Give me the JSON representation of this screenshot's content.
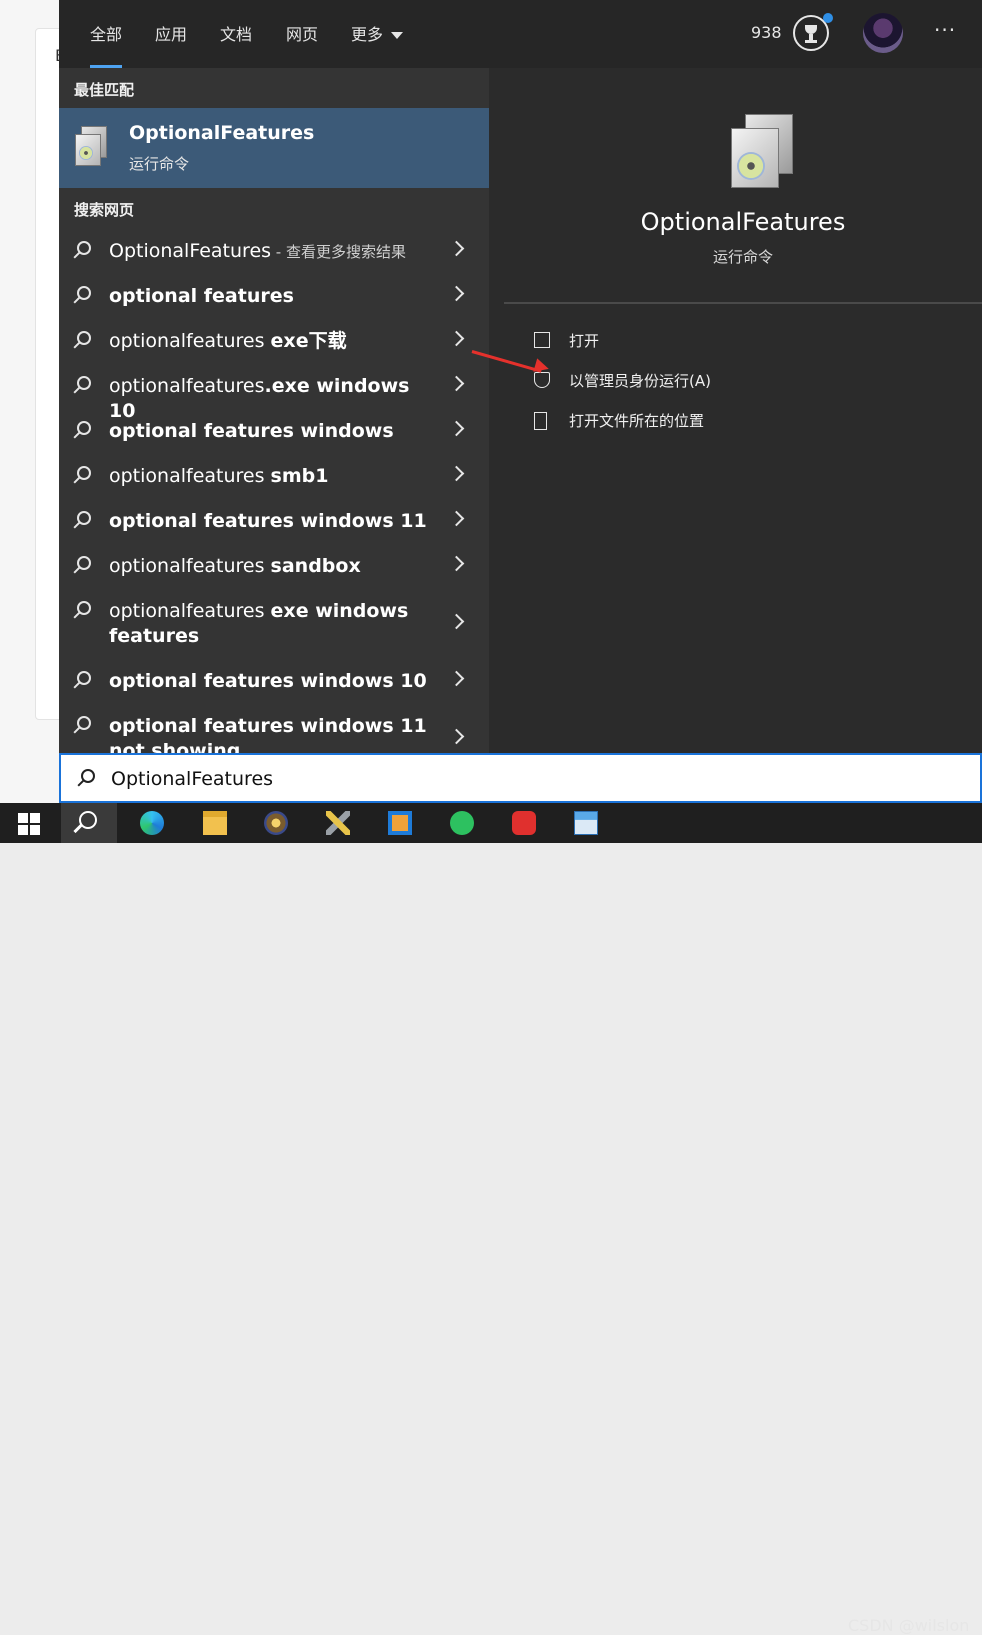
{
  "tabs": [
    {
      "label": "全部"
    },
    {
      "label": "应用"
    },
    {
      "label": "文档"
    },
    {
      "label": "网页"
    },
    {
      "label": "更多"
    }
  ],
  "header": {
    "points": "938",
    "ellipsis": "···"
  },
  "background": {
    "letter": "B"
  },
  "best_match": {
    "section_label": "最佳匹配",
    "title": "OptionalFeatures",
    "subtitle": "运行命令"
  },
  "web": {
    "section_label": "搜索网页",
    "results": [
      {
        "normal": "OptionalFeatures",
        "bold": "",
        "suffix": " - 查看更多搜索结果"
      },
      {
        "normal": "",
        "bold": "optional features",
        "suffix": ""
      },
      {
        "normal": "optionalfeatures ",
        "bold": "exe下载",
        "suffix": ""
      },
      {
        "normal": "optionalfeatures",
        "bold": ".exe windows 10",
        "suffix": ""
      },
      {
        "normal": "",
        "bold": "optional features windows",
        "suffix": ""
      },
      {
        "normal": "optionalfeatures ",
        "bold": "smb1",
        "suffix": ""
      },
      {
        "normal": "",
        "bold": "optional features windows 11",
        "suffix": ""
      },
      {
        "normal": "optionalfeatures ",
        "bold": "sandbox",
        "suffix": ""
      },
      {
        "normal": "optionalfeatures ",
        "bold": "exe windows features",
        "suffix": ""
      },
      {
        "normal": "",
        "bold": "optional features windows 10",
        "suffix": ""
      },
      {
        "normal": "",
        "bold": "optional features windows 11 not showing",
        "suffix": ""
      }
    ]
  },
  "detail": {
    "title": "OptionalFeatures",
    "subtitle": "运行命令",
    "actions": [
      {
        "label": "打开",
        "icon": "open-icon"
      },
      {
        "label": "以管理员身份运行(A)",
        "icon": "shield-admin-icon"
      },
      {
        "label": "打开文件所在的位置",
        "icon": "file-location-icon"
      }
    ]
  },
  "search": {
    "value": "OptionalFeatures"
  },
  "taskbar": {
    "items": [
      "windows-start-icon",
      "search-icon",
      "edge-icon",
      "file-explorer-icon",
      "app-icon",
      "tools-icon",
      "virtualbox-icon",
      "wechat-icon",
      "app-red-icon",
      "control-panel-icon"
    ]
  },
  "watermark": "CSDN @wilslon",
  "colors": {
    "accent": "#4ea3f1",
    "selected_row": "#3c5a78",
    "annotation_arrow": "#e5312c",
    "search_border": "#1a73d9"
  }
}
